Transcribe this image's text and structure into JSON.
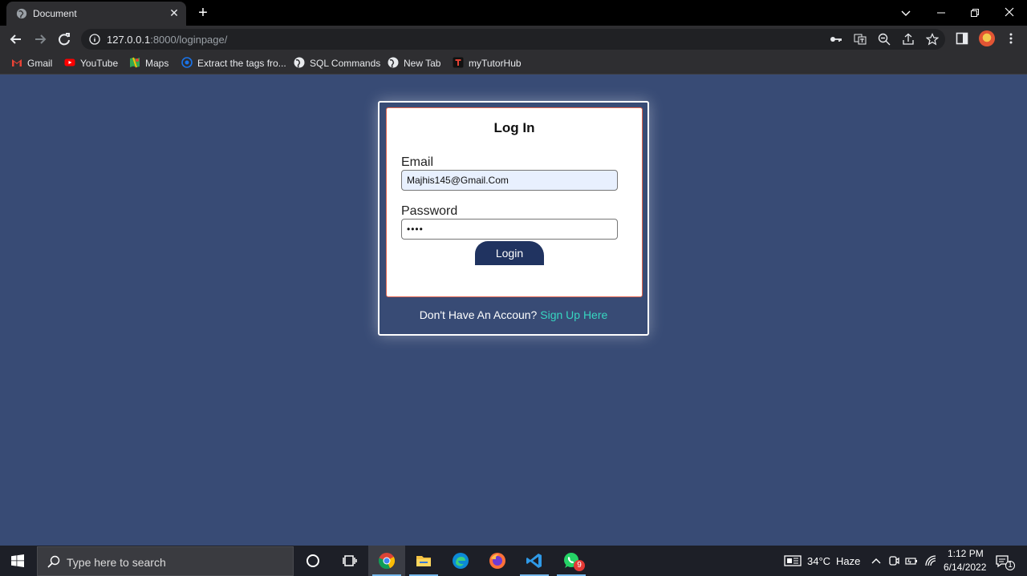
{
  "browser": {
    "tab_title": "Document",
    "tab_close": "✕",
    "new_tab": "+",
    "url_host": "127.0.0.1",
    "url_rest": ":8000/loginpage/",
    "bookmarks": [
      {
        "label": "Gmail",
        "icon": "gmail-icon"
      },
      {
        "label": "YouTube",
        "icon": "youtube-icon"
      },
      {
        "label": "Maps",
        "icon": "maps-icon"
      },
      {
        "label": "Extract the tags fro...",
        "icon": "globe-icon"
      },
      {
        "label": "SQL Commands",
        "icon": "globe-icon"
      },
      {
        "label": "New Tab",
        "icon": "globe-icon"
      },
      {
        "label": "myTutorHub",
        "icon": "mytutorhub-icon"
      }
    ]
  },
  "login": {
    "title": "Log In",
    "email_label": "Email",
    "email_value": "Majhis145@Gmail.Com",
    "password_label": "Password",
    "password_value": "••••",
    "button_label": "Login",
    "signup_prompt": "Don't Have An Accoun?",
    "signup_link": "Sign Up Here"
  },
  "taskbar": {
    "search_placeholder": "Type here to search",
    "weather_temp": "34°C",
    "weather_text": "Haze",
    "time": "1:12 PM",
    "date": "6/14/2022",
    "whatsapp_badge": "9",
    "notification_count": "1"
  },
  "colors": {
    "page_background": "#384b75",
    "button_background": "#203360",
    "link": "#37d6c1",
    "inner_card_border": "#e2664f"
  }
}
